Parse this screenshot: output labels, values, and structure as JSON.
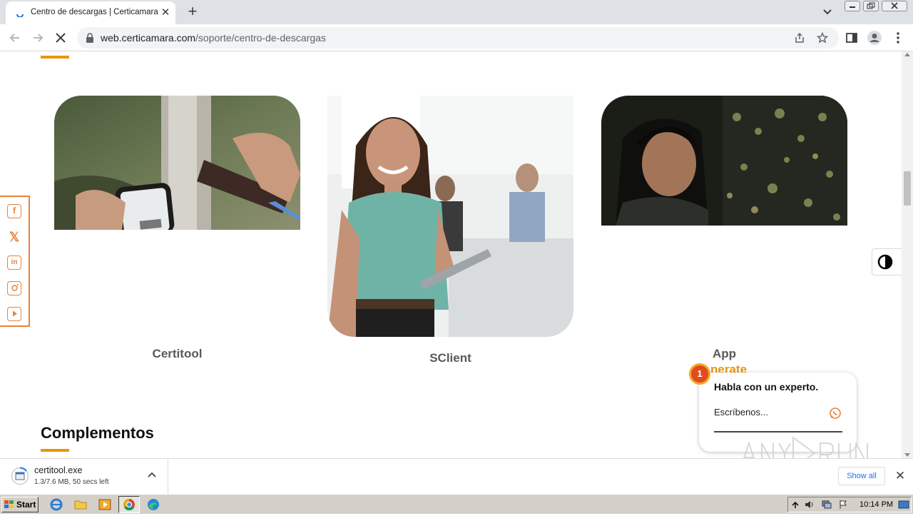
{
  "browser": {
    "tab_title": "Centro de descargas | Certicamara",
    "tab_close": "✕",
    "new_tab": "+",
    "url_host": "web.certicamara.com",
    "url_path": "/soporte/centro-de-descargas"
  },
  "page": {
    "cards": [
      {
        "title": "Certitool"
      },
      {
        "title": "SClient"
      },
      {
        "title": "App",
        "subtitle": "nerate"
      }
    ],
    "section_title": "Complementos"
  },
  "social": [
    "facebook",
    "x",
    "linkedin",
    "instagram",
    "youtube"
  ],
  "chat": {
    "badge": "1",
    "heading": "Habla con un experto.",
    "input_placeholder": "Escríbenos..."
  },
  "download": {
    "file_name": "certitool.exe",
    "status": "1.3/7.6 MB, 50 secs left",
    "show_all": "Show all",
    "close": "✕"
  },
  "watermark": "ANY RUN",
  "taskbar": {
    "start": "Start",
    "clock": "10:14 PM"
  },
  "colors": {
    "accent": "#e8960e",
    "social": "#e8823a",
    "link": "#1a73e8"
  }
}
